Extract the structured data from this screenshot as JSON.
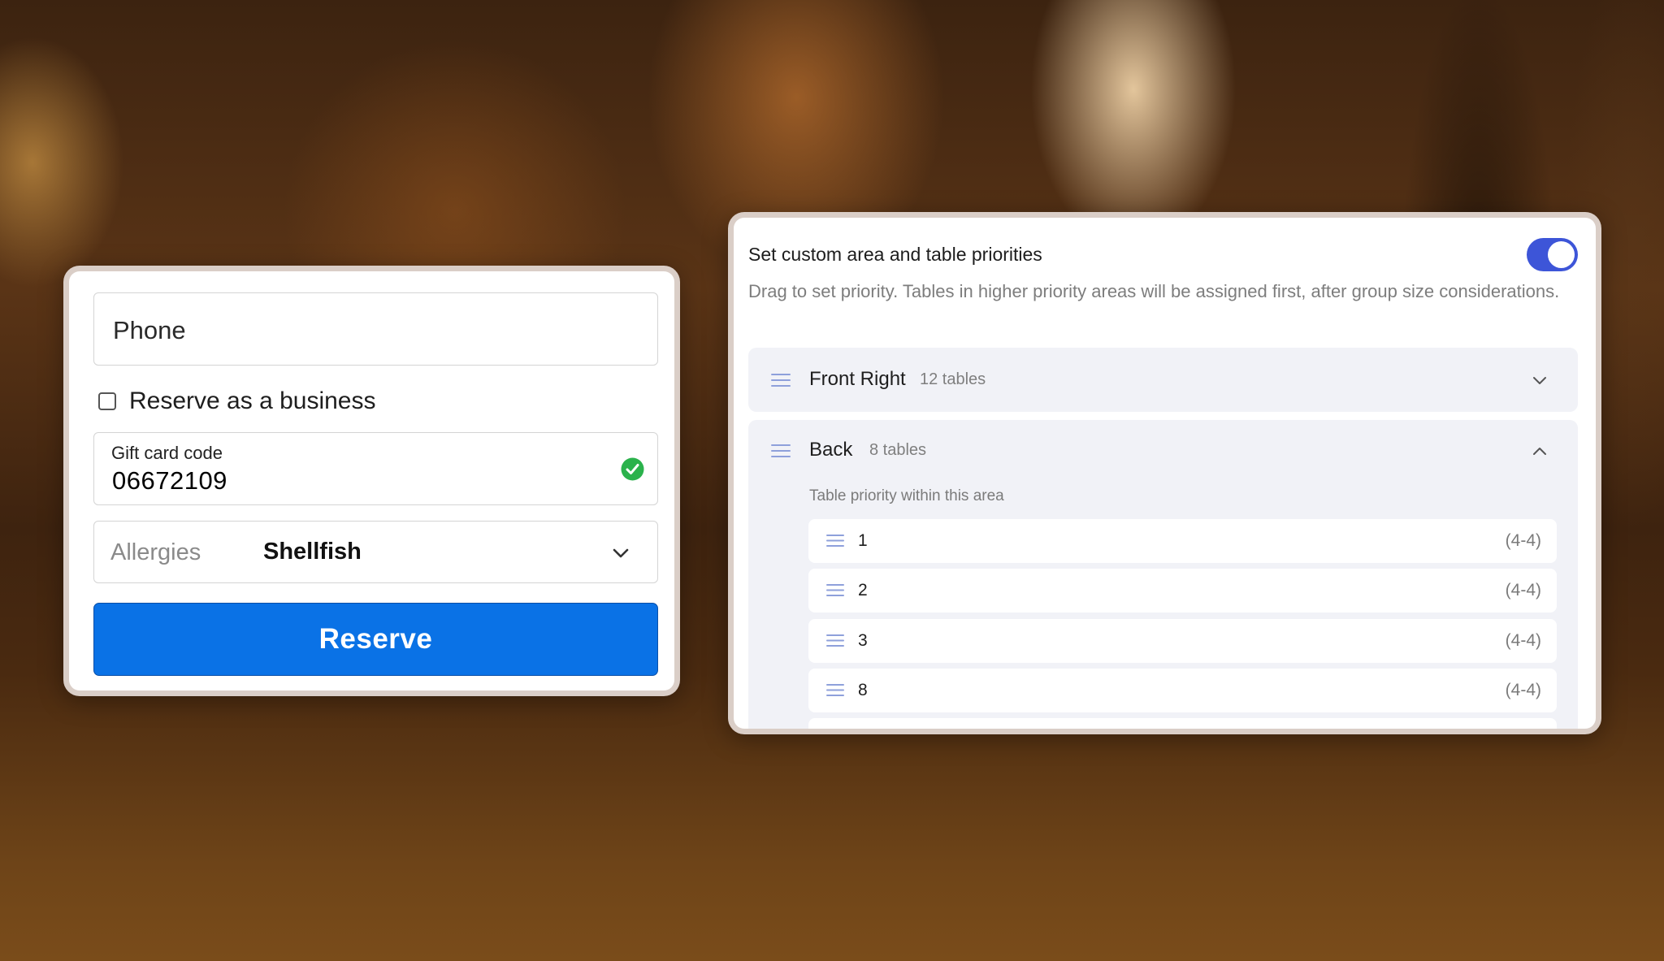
{
  "reservation_form": {
    "phone_placeholder": "Phone",
    "business_checkbox": {
      "label": "Reserve as a business",
      "checked": false
    },
    "gift_card": {
      "label": "Gift card code",
      "value": "06672109",
      "status_icon": "check-circle-icon",
      "status_color": "#2bb24c"
    },
    "allergies": {
      "label": "Allergies",
      "value": "Shellfish"
    },
    "reserve_button_label": "Reserve",
    "button_color": "#0a72e6"
  },
  "priority_settings": {
    "title": "Set custom area and table priorities",
    "toggle_on": true,
    "toggle_color": "#3d55d8",
    "description": "Drag to set priority. Tables in higher priority areas will be assigned first, after group size considerations.",
    "areas": [
      {
        "name": "Front Right",
        "count": "12 tables",
        "expanded": false
      },
      {
        "name": "Back",
        "count": "8 tables",
        "expanded": true,
        "subtitle": "Table priority within this area",
        "tables": [
          {
            "name": "1",
            "range": "(4-4)"
          },
          {
            "name": "2",
            "range": "(4-4)"
          },
          {
            "name": "3",
            "range": "(4-4)"
          },
          {
            "name": "8",
            "range": "(4-4)"
          }
        ]
      }
    ]
  }
}
